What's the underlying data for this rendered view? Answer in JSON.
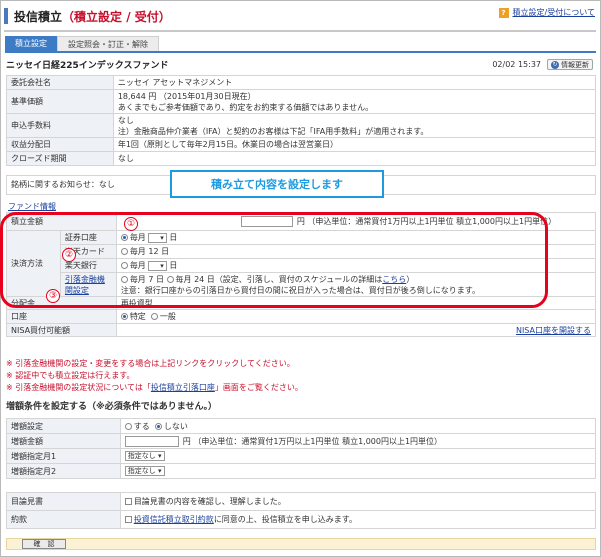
{
  "header": {
    "title_main": "投信積立",
    "title_sub": "（積立設定 / 受付）",
    "help_icon": "?",
    "help_link": "積立設定/受付について"
  },
  "tabs": [
    {
      "label": "積立設定"
    },
    {
      "label": "設定照会・訂正・解除"
    }
  ],
  "fund": {
    "name": "ニッセイ日経225インデックスファンド",
    "timestamp": "02/02 15:37",
    "refresh_label": "情報更新"
  },
  "info_rows": [
    {
      "label": "委託会社名",
      "value": "ニッセイ アセットマネジメント"
    },
    {
      "label": "基準価額",
      "value": "18,644 円 （2015年01月30日現在）",
      "value2": "あくまでもご参考価額であり、約定をお約束する価額ではありません。"
    },
    {
      "label": "申込手数料",
      "value": "なし",
      "value2": "注）金融商品仲介業者（IFA）と契約のお客様は下記「IFA用手数料」が適用されます。"
    },
    {
      "label": "収益分配日",
      "value": "年1回（原則として毎年2月15日。休業日の場合は翌営業日）"
    },
    {
      "label": "クローズド期間",
      "value": "なし"
    }
  ],
  "notice": "銘柄に関するお知らせ：なし",
  "tooltip": "積み立て内容を設定します",
  "section_link": "ファンド情報",
  "setup": {
    "amount_label": "積立金額",
    "amount_unit": "円",
    "amount_hint": "（申込単位：通常買付1万円以上1円単位 積立1,000円以上1円単位）",
    "method_label": "決済方法",
    "methods": [
      {
        "label": "証券口座",
        "option": "毎月",
        "select": "",
        "suffix": "日"
      },
      {
        "label": "楽天カード",
        "option": "毎月 12 日"
      },
      {
        "label": "楽天銀行",
        "option": "毎月",
        "select": "",
        "suffix": "日"
      }
    ],
    "bank_link": "引落金融機関設定",
    "bank_option_a": "毎月 7 日",
    "bank_option_b": "毎月 24 日",
    "bank_option_tail": "（設定、引落し、買付のスケジュールの詳細は",
    "bank_option_link": "こちら",
    "bank_option_end": "）",
    "bank_note": "注意：銀行口座からの引落日から買付日の間に祝日が入った場合は、買付日が後ろ倒しになります。",
    "dist_label": "分配金",
    "dist_value": "再投資型",
    "account_label": "口座",
    "account_opt1": "特定",
    "account_opt2": "一般",
    "nisa_label": "NISA買付可能額",
    "nisa_link": "NISA口座を開設する"
  },
  "annotations": [
    "①",
    "②",
    "③"
  ],
  "notes": [
    "※ 引落金融機関の設定・変更をする場合は上記リンクをクリックしてください。",
    "※ 認証中でも積立設定は行えます。",
    "※ 引落金融機関の設定状況については「",
    "投信積立引落口座",
    "」画面をご覧ください。"
  ],
  "increase": {
    "title": "増額条件を設定する（※必須条件ではありません。）",
    "rows": [
      {
        "label": "増額設定",
        "opt1": "する",
        "opt2": "しない"
      },
      {
        "label": "増額金額",
        "unit": "円",
        "hint": "（申込単位：通常買付1万円以上1円単位 積立1,000円以上1円単位）"
      },
      {
        "label": "増額指定月1",
        "select": "指定なし"
      },
      {
        "label": "増額指定月2",
        "select": "指定なし"
      }
    ]
  },
  "agree": {
    "doc_label": "目論見書",
    "doc_text": "目論見書の内容を確認し、理解しました。",
    "terms_label": "約款",
    "terms_link": "投資信託積立取引約款",
    "terms_text": "に同意の上、投信積立を申し込みます。"
  },
  "confirm_label": "確　認",
  "colors": {
    "accent": "#3d7cc4",
    "alert": "#e8001c",
    "tip": "#1e9be0"
  }
}
